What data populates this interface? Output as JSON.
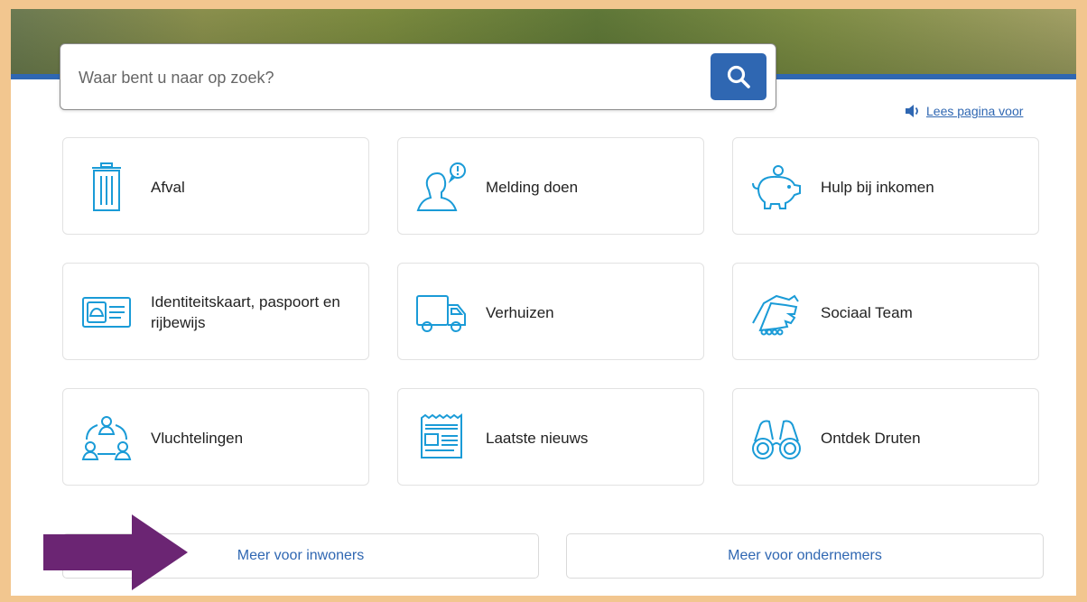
{
  "search": {
    "placeholder": "Waar bent u naar op zoek?",
    "button_icon": "search-icon"
  },
  "readaloud": {
    "icon": "speaker-icon",
    "label": "Lees pagina voor"
  },
  "tiles": [
    {
      "label": "Afval",
      "icon": "trash-bin-icon"
    },
    {
      "label": "Melding doen",
      "icon": "person-alert-icon"
    },
    {
      "label": "Hulp bij inkomen",
      "icon": "piggy-bank-icon"
    },
    {
      "label": "Identiteitskaart, paspoort en rijbewijs",
      "icon": "id-card-icon"
    },
    {
      "label": "Verhuizen",
      "icon": "moving-truck-icon"
    },
    {
      "label": "Sociaal Team",
      "icon": "handshake-icon"
    },
    {
      "label": "Vluchtelingen",
      "icon": "people-network-icon"
    },
    {
      "label": "Laatste nieuws",
      "icon": "newspaper-icon"
    },
    {
      "label": "Ontdek Druten",
      "icon": "binoculars-icon"
    }
  ],
  "more": {
    "residents": "Meer voor inwoners",
    "entrepreneurs": "Meer voor ondernemers"
  },
  "colors": {
    "accent": "#2f67b2",
    "icon": "#1a9bd7",
    "frame": "#f2c68f",
    "arrow": "#6b2573"
  },
  "annotation": {
    "arrow_icon": "arrow-right-icon"
  }
}
